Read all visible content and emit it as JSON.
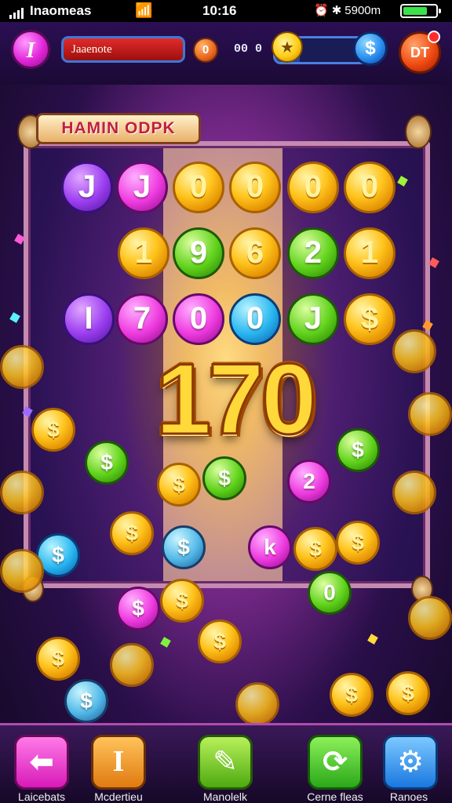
{
  "status_bar": {
    "carrier": "Inaomeas",
    "time": "10:16",
    "battery_text": "5900m",
    "battery_level": 0.78
  },
  "header": {
    "gem_label": "I",
    "player_name": "Jaaenote",
    "coin_value": "0",
    "score": "00 0",
    "progress": 0.25,
    "dollar_symbol": "$",
    "alert_label": "DT"
  },
  "board": {
    "title": "HAMIN ODPK",
    "big_number": "170",
    "rows": [
      [
        {
          "symbol": "J",
          "color": "purple"
        },
        {
          "symbol": "J",
          "color": "magenta"
        },
        {
          "symbol": "0",
          "color": "gold"
        },
        {
          "symbol": "0",
          "color": "gold"
        },
        {
          "symbol": "0",
          "color": "gold"
        },
        {
          "symbol": "0",
          "color": "gold"
        }
      ],
      [
        {
          "symbol": "1",
          "color": "gold"
        },
        {
          "symbol": "9",
          "color": "green"
        },
        {
          "symbol": "6",
          "color": "gold"
        },
        {
          "symbol": "2",
          "color": "green"
        },
        {
          "symbol": "1",
          "color": "gold"
        }
      ],
      [
        {
          "symbol": "I",
          "color": "purple"
        },
        {
          "symbol": "7",
          "color": "magenta"
        },
        {
          "symbol": "0",
          "color": "magenta"
        },
        {
          "symbol": "0",
          "color": "blue"
        },
        {
          "symbol": "J",
          "color": "green"
        },
        {
          "symbol": "$",
          "color": "gold"
        }
      ]
    ],
    "lower_coins": [
      {
        "symbol": "$",
        "color": "gold"
      },
      {
        "symbol": "$",
        "color": "green"
      },
      {
        "symbol": "$",
        "color": "gold"
      },
      {
        "symbol": "$",
        "color": "green"
      },
      {
        "symbol": "2",
        "color": "magenta"
      },
      {
        "symbol": "$",
        "color": "green"
      },
      {
        "symbol": "$",
        "color": "blue"
      },
      {
        "symbol": "$",
        "color": "gold"
      },
      {
        "symbol": "$",
        "color": "teal"
      },
      {
        "symbol": "k",
        "color": "magenta"
      },
      {
        "symbol": "$",
        "color": "gold"
      },
      {
        "symbol": "$",
        "color": "gold"
      },
      {
        "symbol": "$",
        "color": "magenta"
      },
      {
        "symbol": "$",
        "color": "gold"
      },
      {
        "symbol": "0",
        "color": "green"
      },
      {
        "symbol": "$",
        "color": "gold"
      },
      {
        "symbol": "$",
        "color": "gold"
      },
      {
        "symbol": "$",
        "color": "gold"
      },
      {
        "symbol": "$",
        "color": "teal"
      },
      {
        "symbol": "$",
        "color": "gold"
      }
    ]
  },
  "bottom_nav": [
    {
      "id": "back",
      "icon": "arrow-left-icon",
      "glyph": "⬅",
      "label": "Laicebats"
    },
    {
      "id": "one",
      "icon": "numeral-one-icon",
      "glyph": "I",
      "label": "Mcdertieu"
    },
    {
      "id": "edit",
      "icon": "pencil-arrow-icon",
      "glyph": "✎",
      "label": "Manolelk"
    },
    {
      "id": "refresh",
      "icon": "refresh-icon",
      "glyph": "⟳",
      "label": "Cerne fleas"
    },
    {
      "id": "gear",
      "icon": "gear-icon",
      "glyph": "⚙",
      "label": "Ranoes"
    }
  ]
}
